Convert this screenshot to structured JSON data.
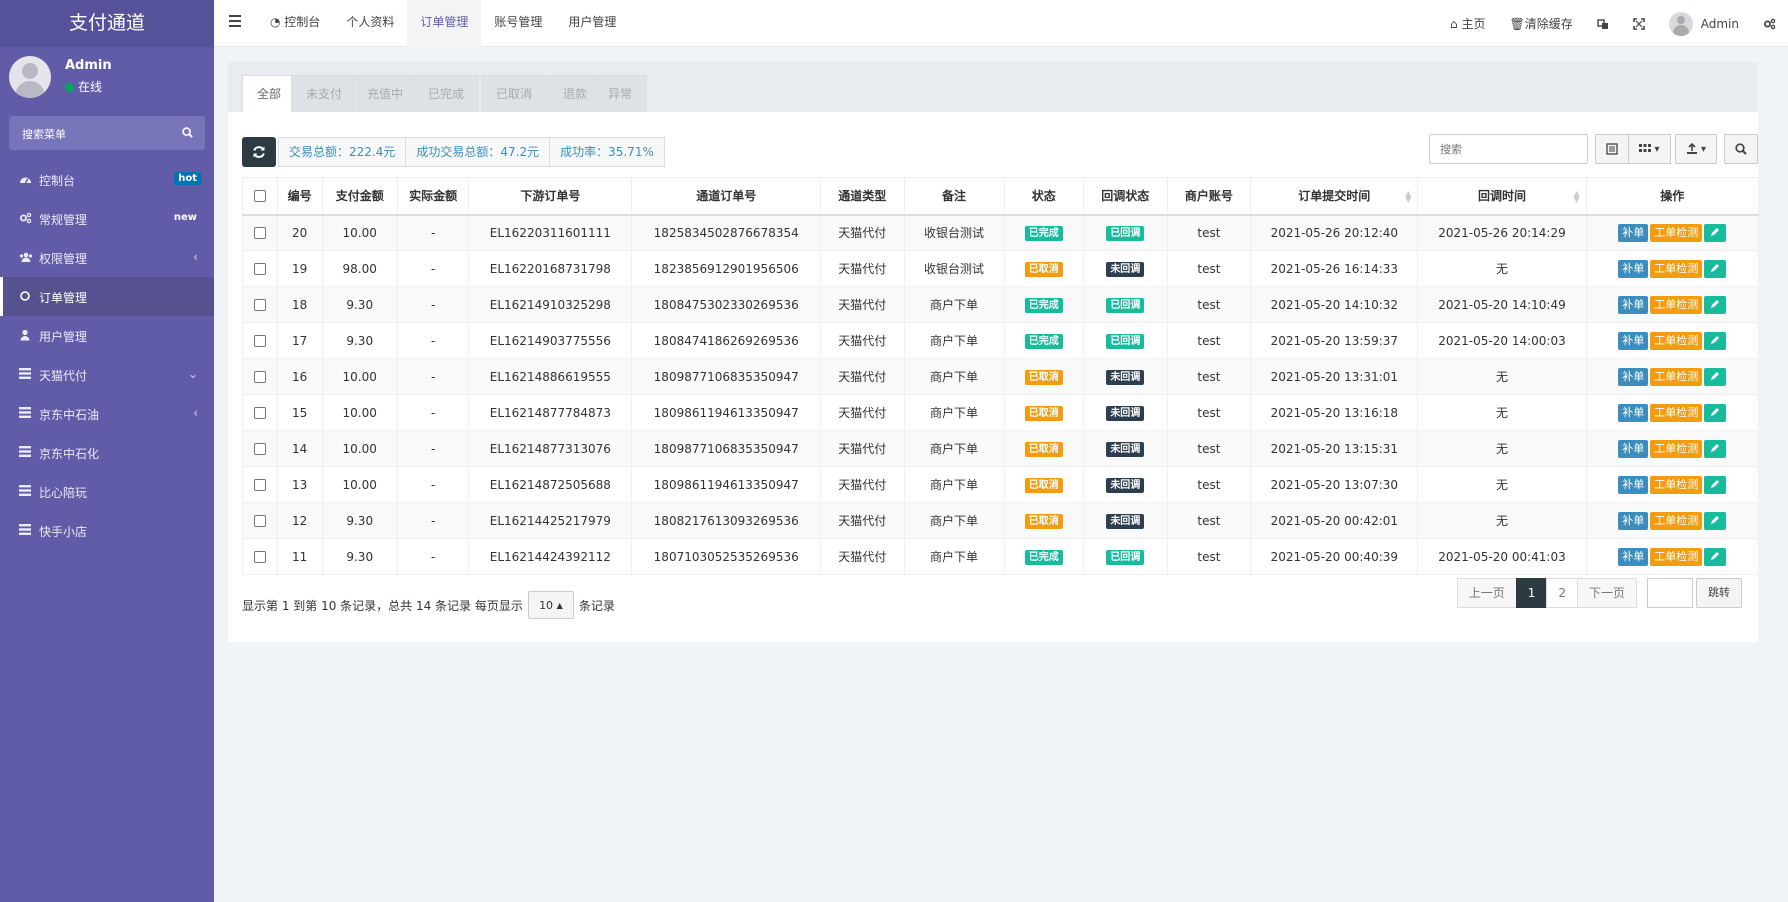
{
  "sidebar": {
    "logo": "支付通道",
    "user_name": "Admin",
    "user_status": "在线",
    "search_label": "搜索菜单",
    "items": [
      {
        "label": "控制台",
        "badge": "hot",
        "icon": "dashboard-icon"
      },
      {
        "label": "常规管理",
        "badge": "new",
        "icon": "cogs-icon"
      },
      {
        "label": "权限管理",
        "arrow": "‹",
        "icon": "group-icon"
      },
      {
        "label": "订单管理",
        "icon": "circle-icon",
        "active": true
      },
      {
        "label": "用户管理",
        "icon": "user-icon"
      },
      {
        "label": "天猫代付",
        "arrow": "⌄",
        "icon": "list-icon"
      },
      {
        "label": "京东中石油",
        "arrow": "‹",
        "icon": "list-icon"
      },
      {
        "label": "京东中石化",
        "icon": "list-icon"
      },
      {
        "label": "比心陪玩",
        "icon": "list-icon"
      },
      {
        "label": "快手小店",
        "icon": "list-icon"
      }
    ]
  },
  "topbar": {
    "nav": [
      "控制台",
      "个人资料",
      "订单管理",
      "账号管理",
      "用户管理"
    ],
    "home": "主页",
    "clear_cache": "清除缓存",
    "admin": "Admin"
  },
  "tabs": [
    "全部",
    "未支付",
    "充值中",
    "已完成",
    "已取消",
    "退款",
    "异常"
  ],
  "stats": {
    "total": "交易总额：222.4元",
    "success_total": "成功交易总额：47.2元",
    "rate": "成功率：35.71%"
  },
  "search": {
    "placeholder": "搜索"
  },
  "table": {
    "headers": [
      "编号",
      "支付金额",
      "实际金额",
      "下游订单号",
      "通道订单号",
      "通道类型",
      "备注",
      "状态",
      "回调状态",
      "商户账号",
      "订单提交时间",
      "回调时间",
      "操作"
    ],
    "op_labels": {
      "bu": "补单",
      "check": "工单检测"
    },
    "rows": [
      {
        "id": "20",
        "amount": "10.00",
        "actual": "-",
        "down_no": "EL16220311601111",
        "chan_no": "1825834502876678354",
        "type": "天猫代付",
        "remark": "收银台测试",
        "status": "已完成",
        "cb_status": "已回调",
        "merchant": "test",
        "submit_time": "2021-05-26 20:12:40",
        "cb_time": "2021-05-26 20:14:29"
      },
      {
        "id": "19",
        "amount": "98.00",
        "actual": "-",
        "down_no": "EL16220168731798",
        "chan_no": "1823856912901956506",
        "type": "天猫代付",
        "remark": "收银台测试",
        "status": "已取消",
        "cb_status": "未回调",
        "merchant": "test",
        "submit_time": "2021-05-26 16:14:33",
        "cb_time": "无"
      },
      {
        "id": "18",
        "amount": "9.30",
        "actual": "-",
        "down_no": "EL16214910325298",
        "chan_no": "1808475302330269536",
        "type": "天猫代付",
        "remark": "商户下单",
        "status": "已完成",
        "cb_status": "已回调",
        "merchant": "test",
        "submit_time": "2021-05-20 14:10:32",
        "cb_time": "2021-05-20 14:10:49"
      },
      {
        "id": "17",
        "amount": "9.30",
        "actual": "-",
        "down_no": "EL16214903775556",
        "chan_no": "1808474186269269536",
        "type": "天猫代付",
        "remark": "商户下单",
        "status": "已完成",
        "cb_status": "已回调",
        "merchant": "test",
        "submit_time": "2021-05-20 13:59:37",
        "cb_time": "2021-05-20 14:00:03"
      },
      {
        "id": "16",
        "amount": "10.00",
        "actual": "-",
        "down_no": "EL16214886619555",
        "chan_no": "1809877106835350947",
        "type": "天猫代付",
        "remark": "商户下单",
        "status": "已取消",
        "cb_status": "未回调",
        "merchant": "test",
        "submit_time": "2021-05-20 13:31:01",
        "cb_time": "无"
      },
      {
        "id": "15",
        "amount": "10.00",
        "actual": "-",
        "down_no": "EL16214877784873",
        "chan_no": "1809861194613350947",
        "type": "天猫代付",
        "remark": "商户下单",
        "status": "已取消",
        "cb_status": "未回调",
        "merchant": "test",
        "submit_time": "2021-05-20 13:16:18",
        "cb_time": "无"
      },
      {
        "id": "14",
        "amount": "10.00",
        "actual": "-",
        "down_no": "EL16214877313076",
        "chan_no": "1809877106835350947",
        "type": "天猫代付",
        "remark": "商户下单",
        "status": "已取消",
        "cb_status": "未回调",
        "merchant": "test",
        "submit_time": "2021-05-20 13:15:31",
        "cb_time": "无"
      },
      {
        "id": "13",
        "amount": "10.00",
        "actual": "-",
        "down_no": "EL16214872505688",
        "chan_no": "1809861194613350947",
        "type": "天猫代付",
        "remark": "商户下单",
        "status": "已取消",
        "cb_status": "未回调",
        "merchant": "test",
        "submit_time": "2021-05-20 13:07:30",
        "cb_time": "无"
      },
      {
        "id": "12",
        "amount": "9.30",
        "actual": "-",
        "down_no": "EL16214425217979",
        "chan_no": "1808217613093269536",
        "type": "天猫代付",
        "remark": "商户下单",
        "status": "已取消",
        "cb_status": "未回调",
        "merchant": "test",
        "submit_time": "2021-05-20 00:42:01",
        "cb_time": "无"
      },
      {
        "id": "11",
        "amount": "9.30",
        "actual": "-",
        "down_no": "EL16214424392112",
        "chan_no": "1807103052535269536",
        "type": "天猫代付",
        "remark": "商户下单",
        "status": "已完成",
        "cb_status": "已回调",
        "merchant": "test",
        "submit_time": "2021-05-20 00:40:39",
        "cb_time": "2021-05-20 00:41:03"
      }
    ]
  },
  "footer": {
    "info_prefix": "显示第 1 到第 10 条记录，总共 14 条记录 每页显示",
    "page_size": "10",
    "info_suffix": "条记录",
    "prev": "上一页",
    "pages": [
      "1",
      "2"
    ],
    "next": "下一页",
    "jump": "跳转"
  },
  "colors": {
    "sidebar": "#605ca8",
    "accent": "#3c8dbc",
    "success": "#18bc9c",
    "warning": "#f39c12",
    "dark": "#2c3e50"
  }
}
